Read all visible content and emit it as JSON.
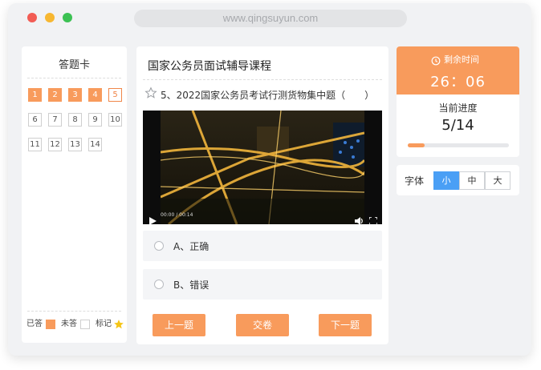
{
  "browser": {
    "url": "www.qingsuyun.com"
  },
  "answer_card": {
    "title": "答题卡",
    "questions": [
      {
        "label": "1",
        "state": "answered"
      },
      {
        "label": "2",
        "state": "answered"
      },
      {
        "label": "3",
        "state": "answered"
      },
      {
        "label": "4",
        "state": "answered"
      },
      {
        "label": "5",
        "state": "current"
      },
      {
        "label": "6",
        "state": "unanswered"
      },
      {
        "label": "7",
        "state": "unanswered"
      },
      {
        "label": "8",
        "state": "unanswered"
      },
      {
        "label": "9",
        "state": "unanswered"
      },
      {
        "label": "10",
        "state": "unanswered"
      },
      {
        "label": "11",
        "state": "unanswered"
      },
      {
        "label": "12",
        "state": "unanswered"
      },
      {
        "label": "13",
        "state": "unanswered"
      },
      {
        "label": "14",
        "state": "unanswered"
      }
    ],
    "legend": {
      "answered": "已答",
      "unanswered": "未答",
      "marked": "标记"
    }
  },
  "main": {
    "course_title": "国家公务员面试辅导课程",
    "question_text": "5、2022国家公务员考试行测货物集中题（　　）",
    "video": {
      "time": "00:00 / 00:14"
    },
    "options": [
      {
        "label": "A、正确"
      },
      {
        "label": "B、错误"
      }
    ],
    "buttons": {
      "prev": "上一题",
      "submit": "交卷",
      "next": "下一题"
    }
  },
  "timer": {
    "label": "剩余时间",
    "value": "26：06",
    "progress_label": "当前进度",
    "progress_value": "5/14",
    "progress_fraction": 0.17
  },
  "font_size": {
    "label": "字体",
    "options": [
      "小",
      "中",
      "大"
    ],
    "selected": "小"
  },
  "colors": {
    "accent": "#f89b5c",
    "selected_blue": "#4a9ff5",
    "star": "#f5c518"
  }
}
